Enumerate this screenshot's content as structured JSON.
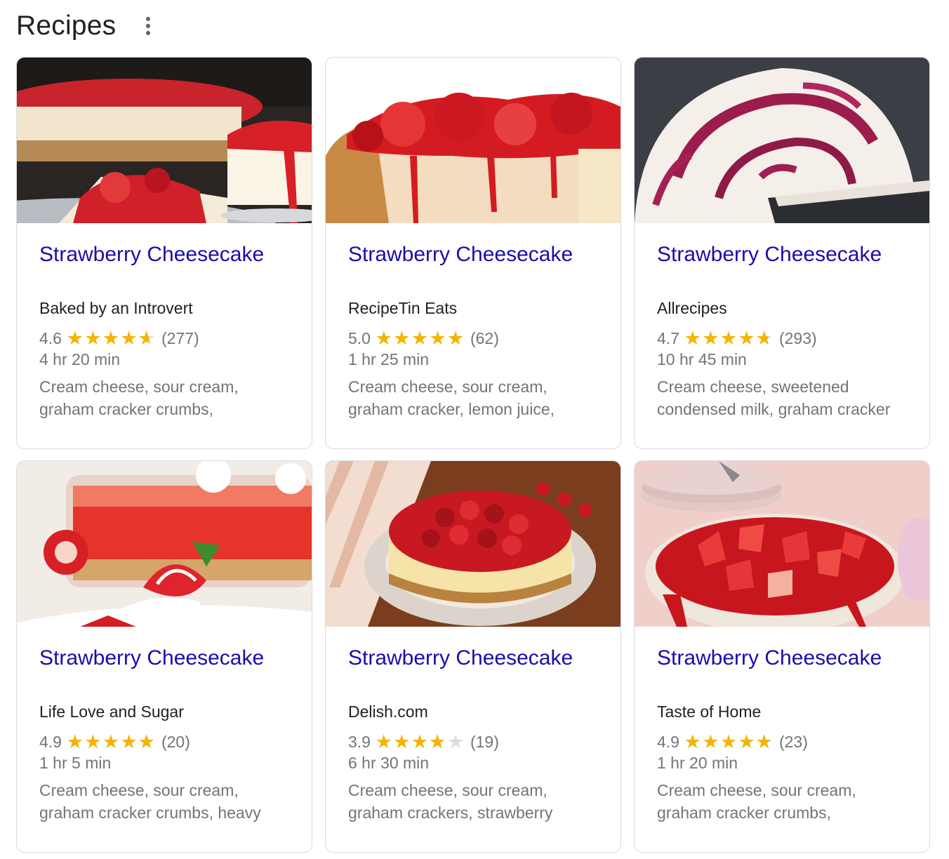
{
  "header": {
    "title": "Recipes"
  },
  "cards": [
    {
      "title": "Strawberry Cheesecake",
      "source": "Baked by an Introvert",
      "rating": "4.6",
      "stars": 4.6,
      "reviews": "(277)",
      "time": "4 hr 20 min",
      "ingredients_line1": "Cream cheese, sour cream,",
      "ingredients_line2": "graham cracker crumbs,"
    },
    {
      "title": "Strawberry Cheesecake",
      "source": "RecipeTin Eats",
      "rating": "5.0",
      "stars": 5.0,
      "reviews": "(62)",
      "time": "1 hr 25 min",
      "ingredients_line1": "Cream cheese, sour cream,",
      "ingredients_line2": "graham cracker, lemon juice,"
    },
    {
      "title": "Strawberry Cheesecake",
      "source": "Allrecipes",
      "rating": "4.7",
      "stars": 4.7,
      "reviews": "(293)",
      "time": "10 hr 45 min",
      "ingredients_line1": "Cream cheese, sweetened",
      "ingredients_line2": "condensed milk, graham cracker"
    },
    {
      "title": "Strawberry Cheesecake",
      "source": "Life Love and Sugar",
      "rating": "4.9",
      "stars": 4.9,
      "reviews": "(20)",
      "time": "1 hr 5 min",
      "ingredients_line1": "Cream cheese, sour cream,",
      "ingredients_line2": "graham cracker crumbs, heavy"
    },
    {
      "title": "Strawberry Cheesecake",
      "source": "Delish.com",
      "rating": "3.9",
      "stars": 3.9,
      "reviews": "(19)",
      "time": "6 hr 30 min",
      "ingredients_line1": "Cream cheese, sour cream,",
      "ingredients_line2": "graham crackers, strawberry"
    },
    {
      "title": "Strawberry Cheesecake",
      "source": "Taste of Home",
      "rating": "4.9",
      "stars": 4.9,
      "reviews": "(23)",
      "time": "1 hr 20 min",
      "ingredients_line1": "Cream cheese, sour cream,",
      "ingredients_line2": "graham cracker crumbs,"
    }
  ],
  "colors": {
    "link": "#1a0dab",
    "star_filled": "#f4b400",
    "star_empty": "#dadce0",
    "secondary_text": "#70757a"
  }
}
